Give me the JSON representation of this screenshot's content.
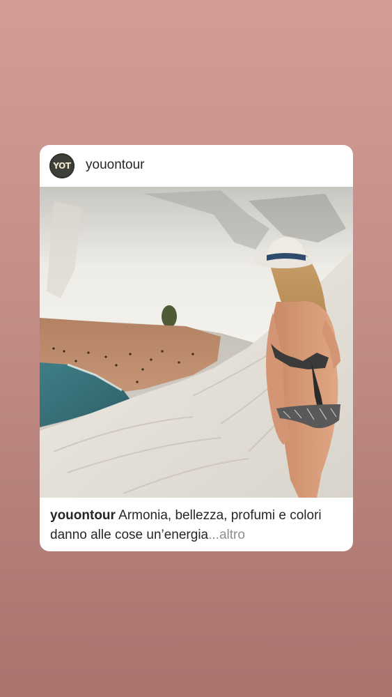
{
  "post": {
    "avatar_text": "YOT",
    "username": "youontour",
    "image_icon": "beach-photo",
    "caption": {
      "user": "youontour",
      "text": " Armonia, bellezza, profumi e colori danno alle cose un’energia",
      "more": "...altro"
    }
  },
  "colors": {
    "background_top": "#d29d95",
    "background_bottom": "#a9736e",
    "card": "#ffffff",
    "text": "#262626",
    "more": "#8e8e8e"
  }
}
